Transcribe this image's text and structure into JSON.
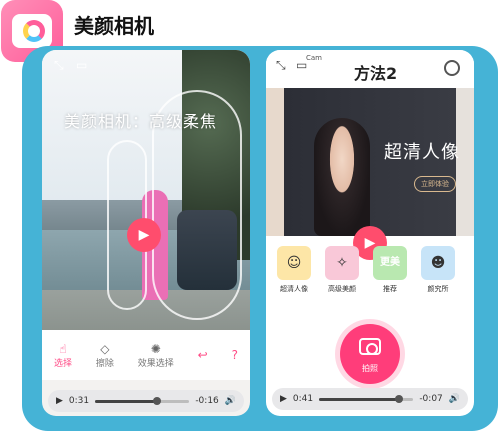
{
  "header": {
    "app_name": "美颜相机"
  },
  "left_video": {
    "watermark": "美颜相机：高级柔焦",
    "tools": [
      {
        "label": "选择",
        "icon": "hand-icon"
      },
      {
        "label": "擦除",
        "icon": "eraser-icon"
      },
      {
        "label": "效果选择",
        "icon": "effect-icon"
      },
      {
        "label": "↩",
        "icon": "undo-icon"
      },
      {
        "label": "?",
        "icon": "help-icon"
      }
    ],
    "player": {
      "elapsed": "0:31",
      "remaining": "-0:16",
      "progress": 0.66
    }
  },
  "right_video": {
    "title": "方法2",
    "cam_label": "Cam",
    "banner_text": "超清人像",
    "banner_tag": "超清人像",
    "banner_button": "立即体验",
    "features": [
      {
        "label": "超清人像",
        "icon": "face-smile-icon",
        "color": "#fde6a7"
      },
      {
        "label": "高级美颜",
        "icon": "beauty-wand-icon",
        "color": "#f9c8d8"
      },
      {
        "label": "推荐",
        "icon": "recommend-icon",
        "color": "#b9e8b0"
      },
      {
        "label": "颜究所",
        "icon": "research-icon",
        "color": "#c7e4f8"
      }
    ],
    "shoot_label": "拍照",
    "player": {
      "elapsed": "0:41",
      "remaining": "-0:07",
      "progress": 0.85
    }
  }
}
